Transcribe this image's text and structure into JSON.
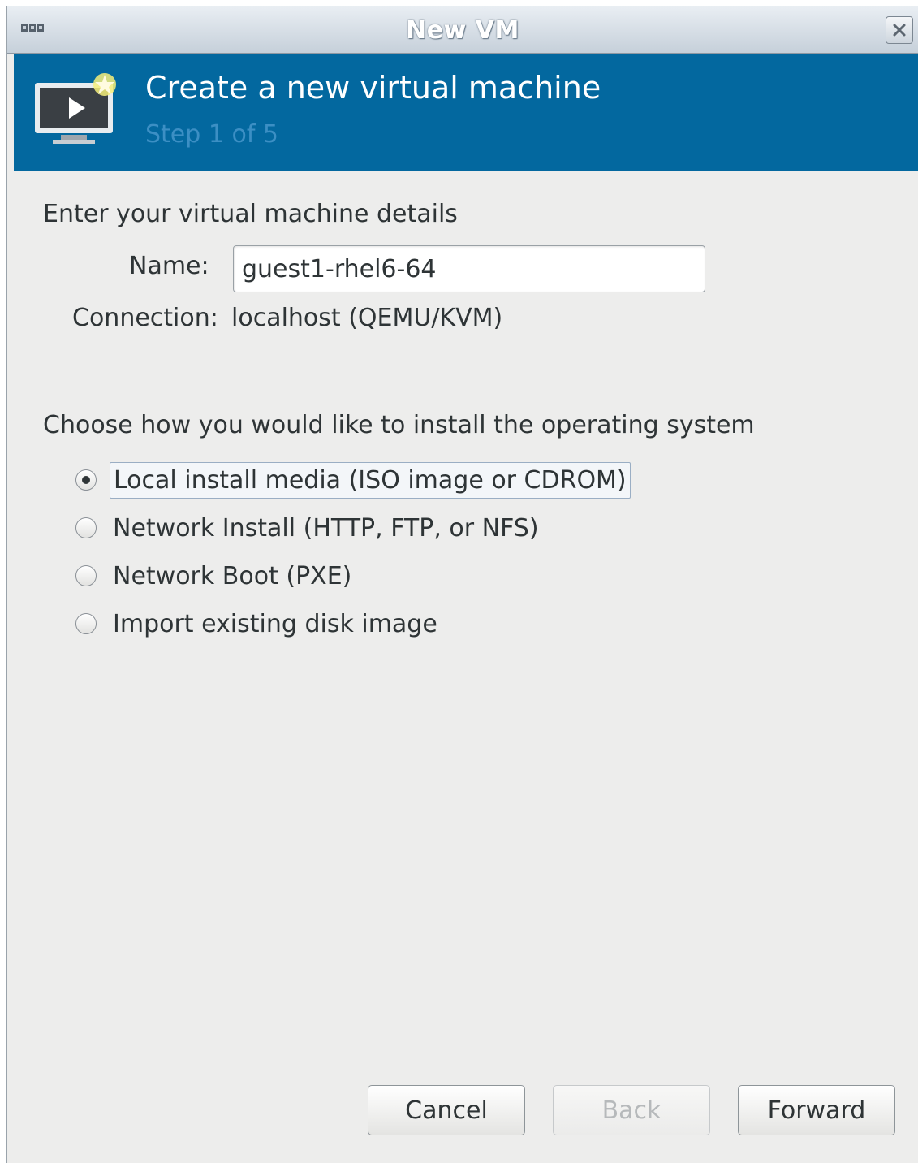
{
  "window": {
    "title": "New VM",
    "close_icon": "close-icon",
    "app_icon": "vm-manager-icon"
  },
  "banner": {
    "title": "Create a new virtual machine",
    "step": "Step 1 of 5",
    "icon": "new-vm-monitor-icon",
    "background": "#03689f"
  },
  "details": {
    "heading": "Enter your virtual machine details",
    "name_label": "Name:",
    "name_value": "guest1-rhel6-64",
    "connection_label": "Connection:",
    "connection_value": "localhost (QEMU/KVM)"
  },
  "install": {
    "heading": "Choose how you would like to install the operating system",
    "options": [
      {
        "label": "Local install media (ISO image or CDROM)",
        "checked": true
      },
      {
        "label": "Network Install (HTTP, FTP, or NFS)",
        "checked": false
      },
      {
        "label": "Network Boot (PXE)",
        "checked": false
      },
      {
        "label": "Import existing disk image",
        "checked": false
      }
    ]
  },
  "buttons": {
    "cancel": "Cancel",
    "back": "Back",
    "forward": "Forward"
  }
}
